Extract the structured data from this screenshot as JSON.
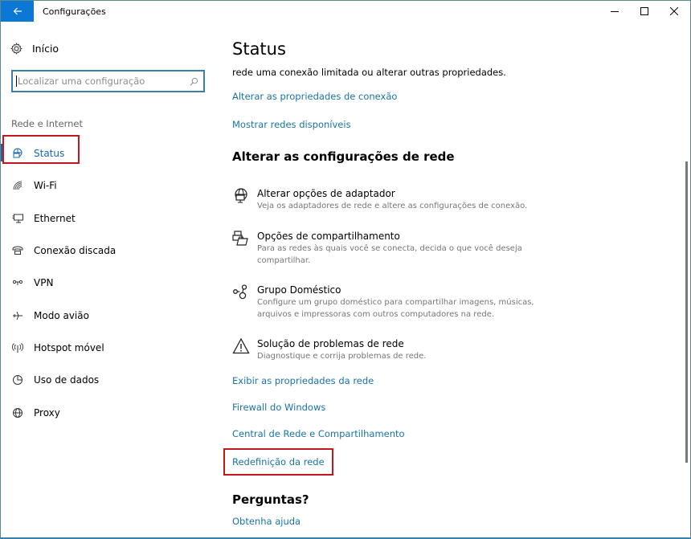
{
  "window": {
    "title": "Configurações",
    "controls": {
      "minimize": "minimize",
      "maximize": "maximize",
      "close": "close"
    }
  },
  "sidebar": {
    "home_label": "Início",
    "search_placeholder": "Localizar uma configuração",
    "section_label": "Rede e Internet",
    "items": [
      {
        "label": "Status",
        "icon": "status-icon",
        "active": true
      },
      {
        "label": "Wi-Fi",
        "icon": "wifi-icon",
        "active": false
      },
      {
        "label": "Ethernet",
        "icon": "ethernet-icon",
        "active": false
      },
      {
        "label": "Conexão discada",
        "icon": "dialup-icon",
        "active": false
      },
      {
        "label": "VPN",
        "icon": "vpn-icon",
        "active": false
      },
      {
        "label": "Modo avião",
        "icon": "airplane-icon",
        "active": false
      },
      {
        "label": "Hotspot móvel",
        "icon": "hotspot-icon",
        "active": false
      },
      {
        "label": "Uso de dados",
        "icon": "data-usage-icon",
        "active": false
      },
      {
        "label": "Proxy",
        "icon": "proxy-globe-icon",
        "active": false
      }
    ]
  },
  "main": {
    "title": "Status",
    "intro_text": "rede uma conexão limitada ou alterar outras propriedades.",
    "links_top": [
      "Alterar as propriedades de conexão",
      "Mostrar redes disponíveis"
    ],
    "section_heading": "Alterar as configurações de rede",
    "options": [
      {
        "title": "Alterar opções de adaptador",
        "desc": "Veja os adaptadores de rede e altere as configurações de conexão.",
        "icon": "adapter-globe-icon"
      },
      {
        "title": "Opções de compartilhamento",
        "desc": "Para as redes às quais você se conecta, decida o que você deseja compartilhar.",
        "icon": "sharing-icon"
      },
      {
        "title": "Grupo Doméstico",
        "desc": "Configure um grupo doméstico para compartilhar imagens, músicas, arquivos e impressoras com outros computadores na rede.",
        "icon": "homegroup-icon"
      },
      {
        "title": "Solução de problemas de rede",
        "desc": "Diagnostique e corrija problemas de rede.",
        "icon": "warning-icon"
      }
    ],
    "links_bottom": [
      "Exibir as propriedades da rede",
      "Firewall do Windows",
      "Central de Rede e Compartilhamento",
      "Redefinição da rede"
    ],
    "questions_heading": "Perguntas?",
    "help_link": "Obtenha ajuda"
  },
  "colors": {
    "accent": "#0a78d4",
    "link": "#1a73a8",
    "highlight_box": "#c4161c"
  }
}
